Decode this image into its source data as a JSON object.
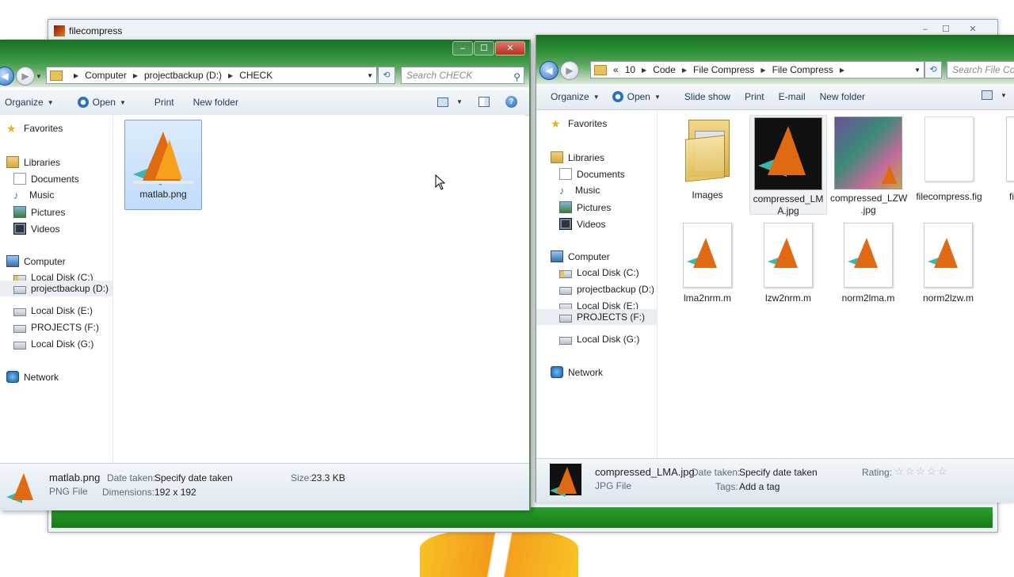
{
  "background_window": {
    "title": "filecompress",
    "controls": [
      "–",
      "☐",
      "✕"
    ]
  },
  "left": {
    "caption_controls": [
      "–",
      "☐",
      "✕"
    ],
    "breadcrumb": [
      "Computer",
      "projectbackup (D:)",
      "CHECK"
    ],
    "search_placeholder": "Search CHECK",
    "toolbar": {
      "organize": "Organize",
      "open": "Open",
      "print": "Print",
      "new_folder": "New folder"
    },
    "nav": {
      "favorites": "Favorites",
      "libraries": "Libraries",
      "library_items": [
        "Documents",
        "Music",
        "Pictures",
        "Videos"
      ],
      "computer": "Computer",
      "drives": [
        "Local Disk (C:)",
        "projectbackup (D:)",
        "Local Disk (E:)",
        "PROJECTS (F:)",
        "Local Disk (G:)"
      ],
      "selected_drive": "projectbackup (D:)",
      "network": "Network"
    },
    "files": [
      {
        "name": "matlab.png"
      }
    ],
    "details": {
      "name": "matlab.png",
      "type": "PNG File",
      "date_label": "Date taken:",
      "date_value": "Specify date taken",
      "dim_label": "Dimensions:",
      "dim_value": "192 x 192",
      "size_label": "Size:",
      "size_value": "23.3 KB"
    }
  },
  "right": {
    "breadcrumb": [
      "«",
      "10",
      "Code",
      "File Compress",
      "File Compress"
    ],
    "search_placeholder": "Search File Com",
    "toolbar": {
      "organize": "Organize",
      "open": "Open",
      "slide_show": "Slide show",
      "print": "Print",
      "email": "E-mail",
      "new_folder": "New folder"
    },
    "nav": {
      "favorites": "Favorites",
      "libraries": "Libraries",
      "library_items": [
        "Documents",
        "Music",
        "Pictures",
        "Videos"
      ],
      "computer": "Computer",
      "drives": [
        "Local Disk (C:)",
        "projectbackup (D:)",
        "Local Disk (E:)",
        "PROJECTS (F:)",
        "Local Disk (G:)"
      ],
      "selected_drive": "PROJECTS (F:)",
      "network": "Network"
    },
    "files": [
      {
        "name": "Images"
      },
      {
        "name_line1": "compressed_LM",
        "name_line2": "A.jpg"
      },
      {
        "name_line1": "compressed_LZW",
        "name_line2": ".jpg"
      },
      {
        "name": "filecompress.fig"
      },
      {
        "name": "filec"
      },
      {
        "name": "lma2nrm.m"
      },
      {
        "name": "lzw2nrm.m"
      },
      {
        "name": "norm2lma.m"
      },
      {
        "name": "norm2lzw.m"
      }
    ],
    "details": {
      "name": "compressed_LMA.jpg",
      "type": "JPG File",
      "date_label": "Date taken:",
      "date_value": "Specify date taken",
      "tags_label": "Tags:",
      "tags_value": "Add a tag",
      "rating_label": "Rating:",
      "rating_value": 0,
      "rating_stars": "☆☆☆☆☆"
    }
  }
}
